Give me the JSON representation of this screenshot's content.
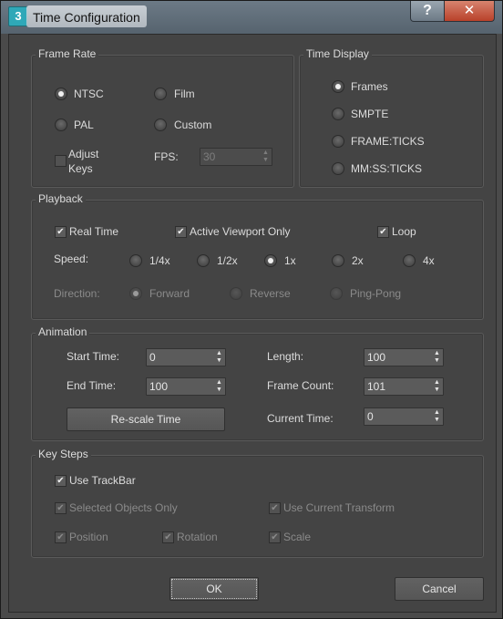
{
  "window": {
    "title": "Time Configuration",
    "icon_label": "3",
    "help_glyph": "?",
    "close_glyph": "✕"
  },
  "frame_rate": {
    "title": "Frame Rate",
    "ntsc": "NTSC",
    "film": "Film",
    "pal": "PAL",
    "custom": "Custom",
    "adjust_keys_1": "Adjust",
    "adjust_keys_2": "Keys",
    "fps_label": "FPS:",
    "fps_value": "30",
    "selected": "NTSC"
  },
  "time_display": {
    "title": "Time Display",
    "frames": "Frames",
    "smpte": "SMPTE",
    "frame_ticks": "FRAME:TICKS",
    "mmss_ticks": "MM:SS:TICKS",
    "selected": "Frames"
  },
  "playback": {
    "title": "Playback",
    "real_time": "Real Time",
    "active_viewport_only": "Active Viewport Only",
    "loop": "Loop",
    "speed_label": "Speed:",
    "speed_quarter": "1/4x",
    "speed_half": "1/2x",
    "speed_1x": "1x",
    "speed_2x": "2x",
    "speed_4x": "4x",
    "speed_selected": "1x",
    "direction_label": "Direction:",
    "forward": "Forward",
    "reverse": "Reverse",
    "ping_pong": "Ping-Pong",
    "direction_selected": "Forward"
  },
  "animation": {
    "title": "Animation",
    "start_time_label": "Start Time:",
    "start_time": "0",
    "end_time_label": "End Time:",
    "end_time": "100",
    "length_label": "Length:",
    "length": "100",
    "frame_count_label": "Frame Count:",
    "frame_count": "101",
    "current_time_label": "Current Time:",
    "current_time": "0",
    "rescale_button": "Re-scale Time"
  },
  "key_steps": {
    "title": "Key Steps",
    "use_trackbar": "Use TrackBar",
    "selected_objects_only": "Selected Objects Only",
    "use_current_transform": "Use Current Transform",
    "position": "Position",
    "rotation": "Rotation",
    "scale": "Scale"
  },
  "footer": {
    "ok": "OK",
    "cancel": "Cancel"
  },
  "colors": {
    "dialog_bg": "#444444",
    "titlebar": "#6c7a86",
    "close_button": "#c0452f"
  }
}
